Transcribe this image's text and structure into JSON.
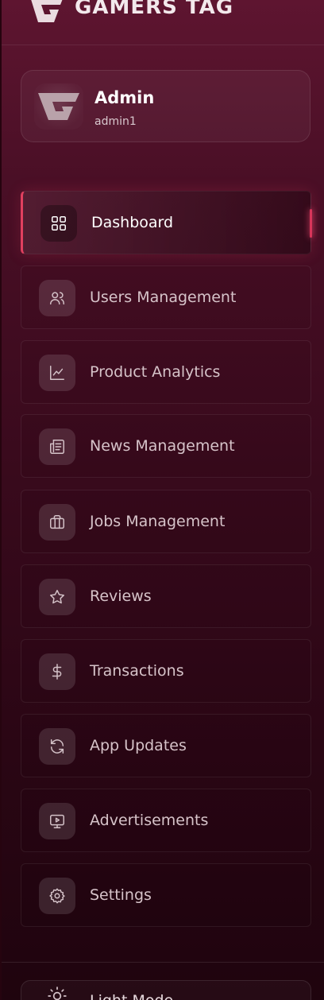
{
  "brand": {
    "name": "GAMERS TAG"
  },
  "profile": {
    "name": "Admin",
    "username": "admin1"
  },
  "nav": {
    "items": [
      {
        "label": "Dashboard",
        "icon": "dashboard-grid-icon",
        "active": true
      },
      {
        "label": "Users Management",
        "icon": "users-icon"
      },
      {
        "label": "Product Analytics",
        "icon": "line-chart-icon"
      },
      {
        "label": "News Management",
        "icon": "newspaper-icon"
      },
      {
        "label": "Jobs Management",
        "icon": "briefcase-icon"
      },
      {
        "label": "Reviews",
        "icon": "star-icon"
      },
      {
        "label": "Transactions",
        "icon": "dollar-icon"
      },
      {
        "label": "App Updates",
        "icon": "refresh-icon"
      },
      {
        "label": "Advertisements",
        "icon": "monitor-play-icon"
      },
      {
        "label": "Settings",
        "icon": "gear-icon"
      }
    ]
  },
  "theme_toggle": {
    "label": "Light Mode",
    "icon": "sun-icon"
  },
  "colors": {
    "accent": "#e0405f",
    "background_top": "#5e1530",
    "background_bottom": "#1f040e"
  }
}
